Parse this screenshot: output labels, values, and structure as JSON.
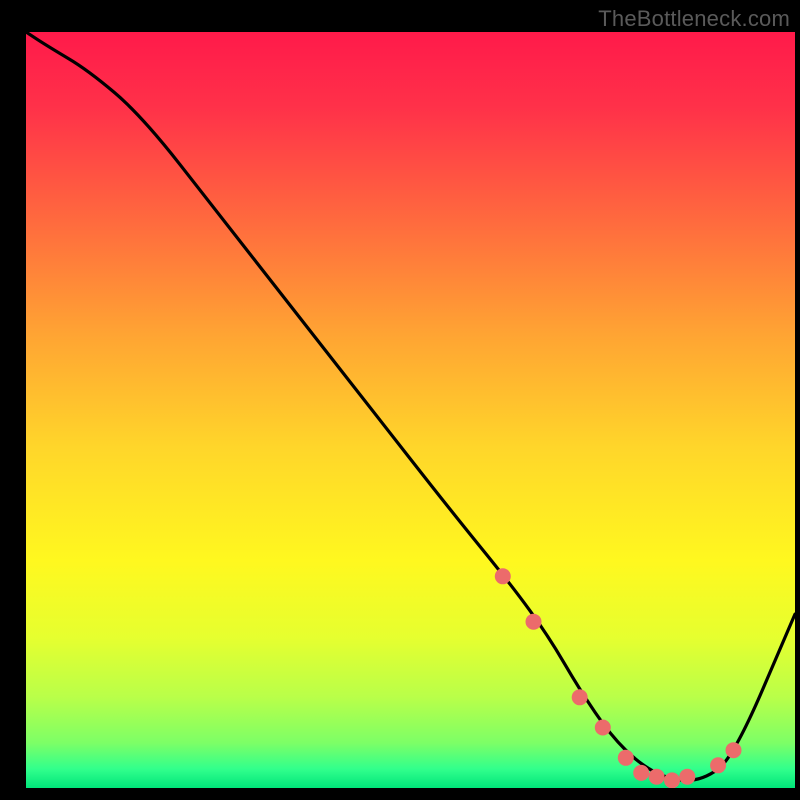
{
  "attribution": "TheBottleneck.com",
  "gradient": {
    "stops": [
      {
        "offset": 0.0,
        "color": "#ff1a4a"
      },
      {
        "offset": 0.1,
        "color": "#ff3149"
      },
      {
        "offset": 0.25,
        "color": "#ff6a3e"
      },
      {
        "offset": 0.4,
        "color": "#ffa433"
      },
      {
        "offset": 0.55,
        "color": "#ffd62a"
      },
      {
        "offset": 0.7,
        "color": "#fff81f"
      },
      {
        "offset": 0.8,
        "color": "#e6ff2f"
      },
      {
        "offset": 0.88,
        "color": "#b9ff49"
      },
      {
        "offset": 0.94,
        "color": "#7dff66"
      },
      {
        "offset": 0.975,
        "color": "#31ff8c"
      },
      {
        "offset": 1.0,
        "color": "#00e57a"
      }
    ]
  },
  "chart_data": {
    "type": "line",
    "title": "",
    "xlabel": "",
    "ylabel": "",
    "xlim": [
      0,
      100
    ],
    "ylim": [
      0,
      100
    ],
    "grid": false,
    "legend": false,
    "series": [
      {
        "name": "bottleneck-curve",
        "x": [
          0,
          3,
          8,
          15,
          25,
          35,
          45,
          55,
          63,
          68,
          72,
          76,
          80,
          84,
          88,
          92,
          100
        ],
        "values": [
          100,
          98,
          95,
          89,
          76,
          63,
          50,
          37,
          27,
          20,
          13,
          7,
          3,
          1,
          1,
          4,
          23
        ]
      }
    ],
    "markers": {
      "name": "highlight-dots",
      "x": [
        62,
        66,
        72,
        75,
        78,
        80,
        82,
        84,
        86,
        90,
        92
      ],
      "values": [
        28,
        22,
        12,
        8,
        4,
        2,
        1.5,
        1,
        1.5,
        3,
        5
      ],
      "color": "#ec6b6b",
      "radius": 8
    }
  }
}
